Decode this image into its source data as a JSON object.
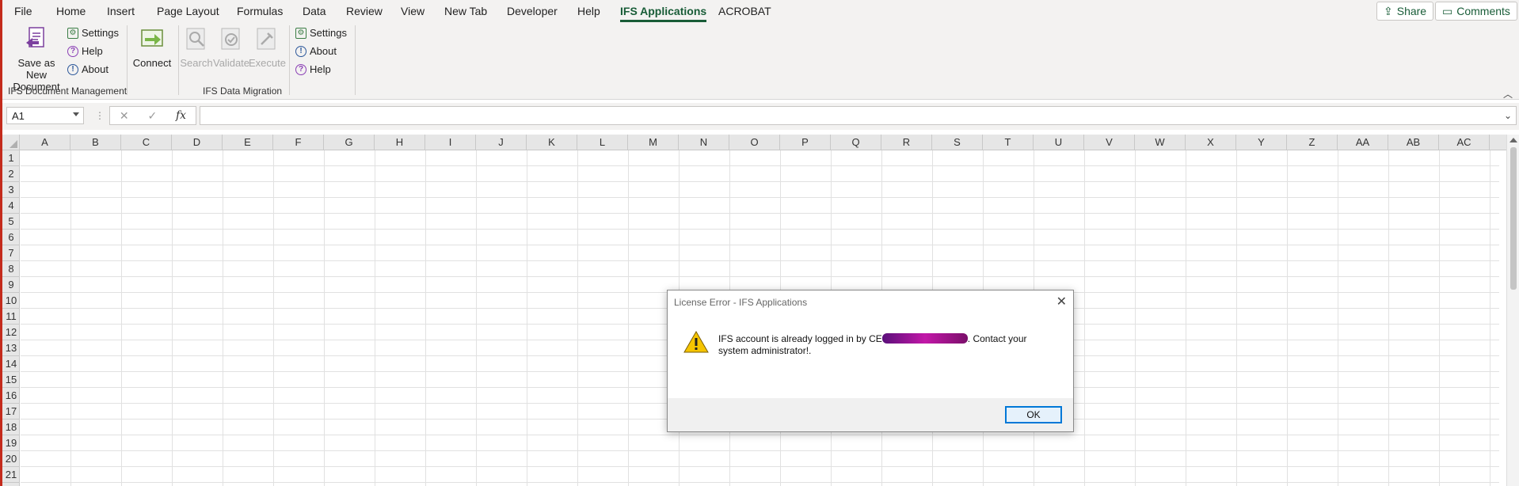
{
  "tabs": [
    "File",
    "Home",
    "Insert",
    "Page Layout",
    "Formulas",
    "Data",
    "Review",
    "View",
    "New Tab",
    "Developer",
    "Help",
    "IFS Applications",
    "ACROBAT"
  ],
  "active_tab": "IFS Applications",
  "top_buttons": {
    "share": "Share",
    "comments": "Comments"
  },
  "ribbon": {
    "doc_mgmt": {
      "label": "IFS Document Management",
      "save_new": {
        "line1": "Save as New",
        "line2": "Document"
      },
      "settings": "Settings",
      "help": "Help",
      "about": "About"
    },
    "data_migration": {
      "label": "IFS Data Migration",
      "connect": "Connect",
      "search": "Search",
      "validate": "Validate",
      "execute": "Execute",
      "settings": "Settings",
      "about": "About",
      "help": "Help"
    }
  },
  "formula_bar": {
    "name_box": "A1",
    "fx": "fx",
    "value": ""
  },
  "grid": {
    "columns": [
      "A",
      "B",
      "C",
      "D",
      "E",
      "F",
      "G",
      "H",
      "I",
      "J",
      "K",
      "L",
      "M",
      "N",
      "O",
      "P",
      "Q",
      "R",
      "S",
      "T",
      "U",
      "V",
      "W",
      "X",
      "Y",
      "Z",
      "AA",
      "AB",
      "AC"
    ],
    "rows": [
      "1",
      "2",
      "3",
      "4",
      "5",
      "6",
      "7",
      "8",
      "9",
      "10",
      "11",
      "12",
      "13",
      "14",
      "15",
      "16",
      "17",
      "18",
      "19",
      "20",
      "21"
    ]
  },
  "dialog": {
    "title": "License Error - IFS Applications",
    "message_before": "IFS account is already logged in by CE",
    "message_after": ". Contact your system administrator!.",
    "ok": "OK"
  },
  "colors": {
    "accent": "#185c37",
    "dialog_ok_border": "#0078d7"
  }
}
